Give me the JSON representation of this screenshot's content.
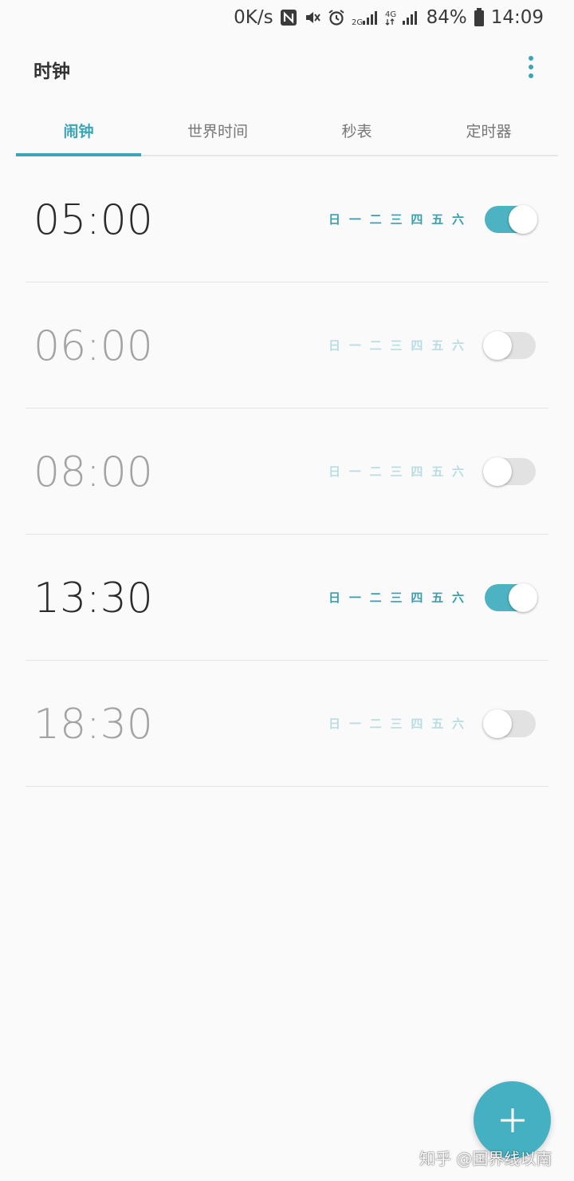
{
  "status_bar": {
    "net_speed": "0K/s",
    "icons": [
      "nfc-icon",
      "mute-icon",
      "alarm-icon",
      "signal-2g-icon",
      "signal-4g-icon",
      "battery-icon"
    ],
    "network_2g": "2G",
    "network_4g": "4G",
    "battery": "84%",
    "time": "14:09"
  },
  "app_bar": {
    "title": "时钟",
    "more_icon": "more-vertical-icon"
  },
  "tabs": [
    {
      "label": "闹钟",
      "active": true
    },
    {
      "label": "世界时间",
      "active": false
    },
    {
      "label": "秒表",
      "active": false
    },
    {
      "label": "定时器",
      "active": false
    }
  ],
  "alarms": [
    {
      "time": "05:00",
      "enabled": true,
      "days": [
        "日",
        "一",
        "二",
        "三",
        "四",
        "五",
        "六"
      ]
    },
    {
      "time": "06:00",
      "enabled": false,
      "days": [
        "日",
        "一",
        "二",
        "三",
        "四",
        "五",
        "六"
      ]
    },
    {
      "time": "08:00",
      "enabled": false,
      "days": [
        "日",
        "一",
        "二",
        "三",
        "四",
        "五",
        "六"
      ]
    },
    {
      "time": "13:30",
      "enabled": true,
      "days": [
        "日",
        "一",
        "二",
        "三",
        "四",
        "五",
        "六"
      ]
    },
    {
      "time": "18:30",
      "enabled": false,
      "days": [
        "日",
        "一",
        "二",
        "三",
        "四",
        "五",
        "六"
      ]
    }
  ],
  "fab": {
    "icon": "plus-icon"
  },
  "watermark": "知乎 @国界线以南",
  "colors": {
    "accent": "#3aa6b5",
    "toggle_on": "#4db3c2",
    "toggle_off": "#e2e2e2",
    "background": "#fafafa"
  }
}
